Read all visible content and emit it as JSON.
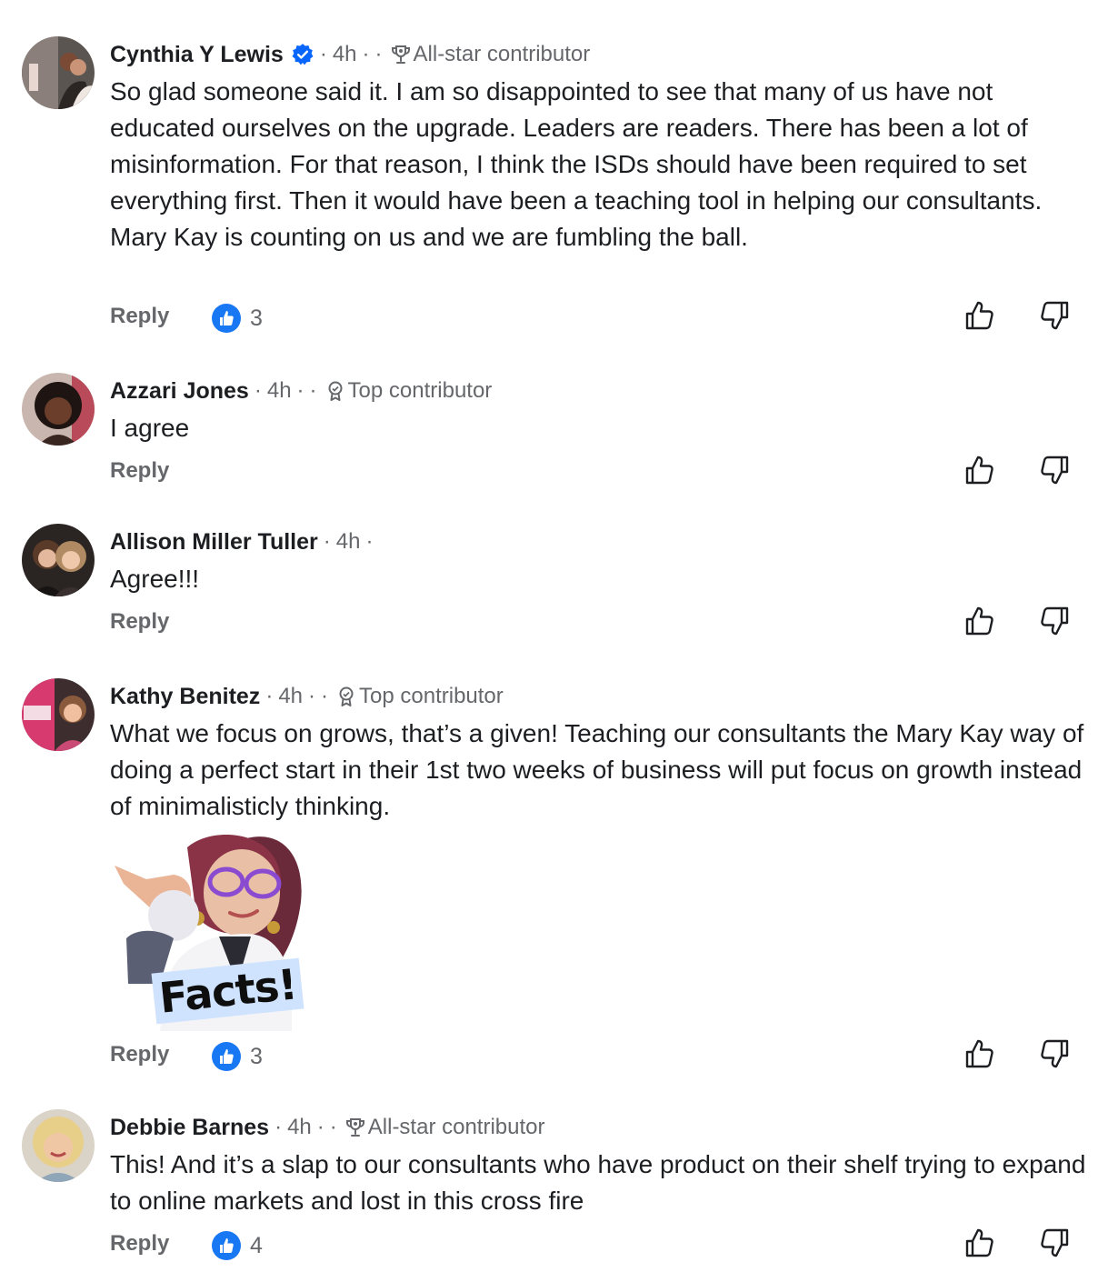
{
  "comments": [
    {
      "author": "Cynthia Y Lewis",
      "verified": true,
      "time": "4h",
      "badge": "All-star contributor",
      "badge_icon": "trophy-icon",
      "text": "So glad someone said it. I am so disappointed to see that many of us have not educated ourselves on the upgrade. Leaders are readers. There has been a lot of misinformation. For that reason, I think the ISDs should have been required to set everything first. Then it would have been a teaching tool in helping our consultants. Mary Kay is counting on us and we are fumbling the ball.",
      "reply_label": "Reply",
      "reactions": "3"
    },
    {
      "author": "Azzari Jones",
      "time": "4h",
      "badge": "Top contributor",
      "badge_icon": "award-icon",
      "text": "I agree",
      "reply_label": "Reply"
    },
    {
      "author": "Allison Miller Tuller",
      "time": "4h",
      "text": "Agree!!!",
      "reply_label": "Reply"
    },
    {
      "author": "Kathy Benitez",
      "time": "4h",
      "badge": "Top contributor",
      "badge_icon": "award-icon",
      "text": "What we focus on grows, that’s a given! Teaching our consultants the Mary Kay way of doing a perfect start in their 1st two weeks of business will put focus on growth instead of minimalisticly thinking.",
      "sticker_text": "Facts!",
      "reply_label": "Reply",
      "reactions": "3"
    },
    {
      "author": "Debbie Barnes",
      "time": "4h",
      "badge": "All-star contributor",
      "badge_icon": "trophy-icon",
      "text": "This!  And it’s a slap to our consultants who have product on their shelf trying to expand to online markets and lost in this cross fire",
      "reply_label": "Reply",
      "reactions": "4"
    }
  ],
  "colors": {
    "text": "#1c1e21",
    "secondary": "#65676b",
    "like_blue": "#1877f2",
    "verified_blue": "#0866ff"
  }
}
